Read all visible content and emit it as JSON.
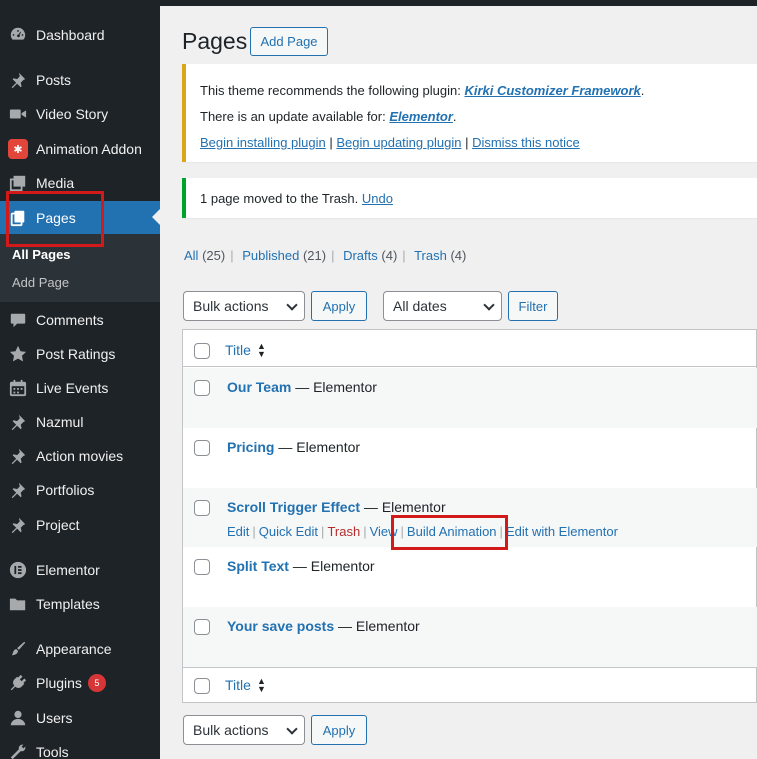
{
  "sidebar": {
    "items": [
      {
        "label": "Dashboard",
        "icon": "dashboard-icon"
      },
      {
        "label": "Posts",
        "icon": "pin-icon"
      },
      {
        "label": "Video Story",
        "icon": "video-icon"
      },
      {
        "label": "Animation Addon",
        "icon": "animation-addon-icon"
      },
      {
        "label": "Media",
        "icon": "media-icon"
      },
      {
        "label": "Pages",
        "icon": "pages-icon"
      },
      {
        "label": "Comments",
        "icon": "comment-icon"
      },
      {
        "label": "Post Ratings",
        "icon": "star-icon"
      },
      {
        "label": "Live Events",
        "icon": "calendar-icon"
      },
      {
        "label": "Nazmul",
        "icon": "pin-icon"
      },
      {
        "label": "Action movies",
        "icon": "pin-icon"
      },
      {
        "label": "Portfolios",
        "icon": "pin-icon"
      },
      {
        "label": "Project",
        "icon": "pin-icon"
      },
      {
        "label": "Elementor",
        "icon": "elementor-icon"
      },
      {
        "label": "Templates",
        "icon": "folder-icon"
      },
      {
        "label": "Appearance",
        "icon": "brush-icon"
      },
      {
        "label": "Plugins",
        "icon": "plug-icon",
        "badge": "5"
      },
      {
        "label": "Users",
        "icon": "user-icon"
      },
      {
        "label": "Tools",
        "icon": "wrench-icon"
      }
    ],
    "submenu": [
      "All Pages",
      "Add Page"
    ]
  },
  "header": {
    "title": "Pages",
    "add_button": "Add Page"
  },
  "notices": {
    "plugin": {
      "line1_text": "This theme recommends the following plugin: ",
      "line1_link": "Kirki Customizer Framework",
      "line2_text": "There is an update available for: ",
      "line2_link": "Elementor",
      "actions": [
        "Begin installing plugin",
        "Begin updating plugin",
        "Dismiss this notice"
      ]
    },
    "trash": {
      "text": "1 page moved to the Trash. ",
      "link": "Undo"
    }
  },
  "filters": {
    "all": {
      "label": "All",
      "count": "(25)"
    },
    "published": {
      "label": "Published",
      "count": "(21)"
    },
    "drafts": {
      "label": "Drafts",
      "count": "(4)"
    },
    "trash": {
      "label": "Trash",
      "count": "(4)"
    }
  },
  "toolbar": {
    "bulk_actions": "Bulk actions",
    "apply": "Apply",
    "dates": "All dates",
    "filter": "Filter"
  },
  "table": {
    "column_title": "Title",
    "rows": [
      {
        "title": "Our Team",
        "state": " — Elementor"
      },
      {
        "title": "Pricing",
        "state": " — Elementor"
      },
      {
        "title": "Scroll Trigger Effect",
        "state": " — Elementor"
      },
      {
        "title": "Split Text",
        "state": " — Elementor"
      },
      {
        "title": "Your save posts",
        "state": " — Elementor"
      }
    ],
    "row_actions": [
      "Edit",
      "Quick Edit",
      "Trash",
      "View",
      "Build Animation",
      "Edit with Elementor"
    ]
  },
  "colors": {
    "sidebar_bg": "#1d2327",
    "accent": "#2271b1",
    "warning": "#dba617",
    "success": "#00a32a",
    "highlight": "#d31a1a"
  }
}
